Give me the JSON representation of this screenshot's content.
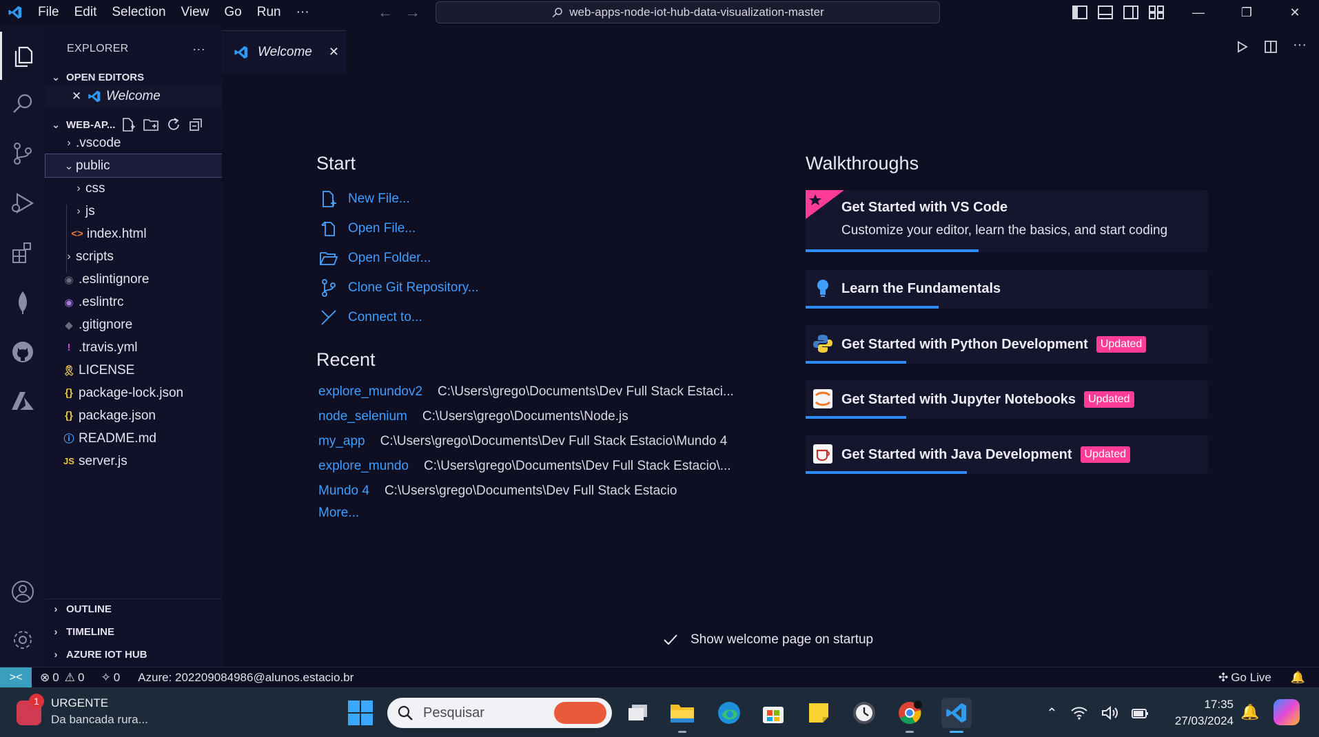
{
  "titlebar": {
    "menu": [
      "File",
      "Edit",
      "Selection",
      "View",
      "Go",
      "Run",
      "···"
    ],
    "search": "web-apps-node-iot-hub-data-visualization-master"
  },
  "sidebar": {
    "title": "EXPLORER",
    "more": "···",
    "open_editors": {
      "header": "OPEN EDITORS",
      "items": [
        {
          "name": "Welcome"
        }
      ]
    },
    "workspace": {
      "header": "WEB-AP...",
      "items": [
        {
          "name": ".vscode",
          "kind": "folder"
        },
        {
          "name": "public",
          "kind": "folder-open"
        },
        {
          "name": "css",
          "kind": "folder"
        },
        {
          "name": "js",
          "kind": "folder"
        },
        {
          "name": "index.html",
          "kind": "html"
        },
        {
          "name": "scripts",
          "kind": "folder"
        },
        {
          "name": ".eslintignore",
          "kind": "eslint"
        },
        {
          "name": ".eslintrc",
          "kind": "eslint"
        },
        {
          "name": ".gitignore",
          "kind": "git"
        },
        {
          "name": ".travis.yml",
          "kind": "yml"
        },
        {
          "name": "LICENSE",
          "kind": "license"
        },
        {
          "name": "package-lock.json",
          "kind": "json"
        },
        {
          "name": "package.json",
          "kind": "json"
        },
        {
          "name": "README.md",
          "kind": "info"
        },
        {
          "name": "server.js",
          "kind": "js"
        }
      ]
    },
    "bottom_sections": [
      "OUTLINE",
      "TIMELINE",
      "AZURE IOT HUB"
    ]
  },
  "tab": {
    "label": "Welcome"
  },
  "welcome": {
    "start_heading": "Start",
    "start_items": [
      "New File...",
      "Open File...",
      "Open Folder...",
      "Clone Git Repository...",
      "Connect to..."
    ],
    "recent_heading": "Recent",
    "recent": [
      {
        "name": "explore_mundov2",
        "path": "C:\\Users\\grego\\Documents\\Dev Full Stack Estaci..."
      },
      {
        "name": "node_selenium",
        "path": "C:\\Users\\grego\\Documents\\Node.js"
      },
      {
        "name": "my_app",
        "path": "C:\\Users\\grego\\Documents\\Dev Full Stack Estacio\\Mundo 4"
      },
      {
        "name": "explore_mundo",
        "path": "C:\\Users\\grego\\Documents\\Dev Full Stack Estacio\\..."
      },
      {
        "name": "Mundo 4",
        "path": "C:\\Users\\grego\\Documents\\Dev Full Stack Estacio"
      }
    ],
    "more": "More...",
    "walkthroughs_heading": "Walkthroughs",
    "walkthroughs": [
      {
        "title": "Get Started with VS Code",
        "description": "Customize your editor, learn the basics, and start coding",
        "badge": "",
        "progress": 0.43
      },
      {
        "title": "Learn the Fundamentals",
        "description": "",
        "badge": "",
        "progress": 0.33
      },
      {
        "title": "Get Started with Python Development",
        "description": "",
        "badge": "Updated",
        "progress": 0.25
      },
      {
        "title": "Get Started with Jupyter Notebooks",
        "description": "",
        "badge": "Updated",
        "progress": 0.25
      },
      {
        "title": "Get Started with Java Development",
        "description": "",
        "badge": "Updated",
        "progress": 0.4
      }
    ],
    "show_on_startup": "Show welcome page on startup"
  },
  "statusbar": {
    "errors": "0",
    "warnings": "0",
    "ports": "0",
    "azure": "Azure: 202209084986@alunos.estacio.br",
    "go_live": "Go Live"
  },
  "taskbar": {
    "notification_badge": "1",
    "notification_title": "URGENTE",
    "notification_text": "Da bancada rura...",
    "search_placeholder": "Pesquisar",
    "time": "17:35",
    "date": "27/03/2024"
  }
}
